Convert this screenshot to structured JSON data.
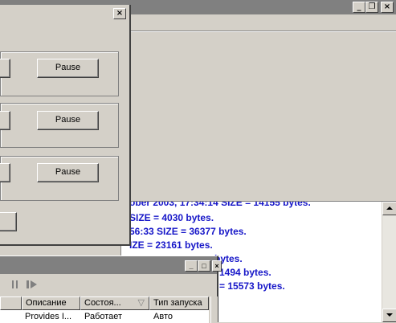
{
  "main_window": {
    "title_buttons": {
      "minimize": "_",
      "restore": "❐",
      "close": "×"
    }
  },
  "log": {
    "lines": [
      "ober 2003, 17:34:14    SIZE = 14155 bytes.",
      "SIZE = 4030 bytes.",
      "56:33    SIZE = 36377 bytes.",
      "IZE = 23161 bytes.",
      "bytes.",
      "1494 bytes.",
      "= 15573 bytes."
    ]
  },
  "dialog": {
    "close_glyph": "×",
    "pause_label": "Pause"
  },
  "services": {
    "title_buttons": {
      "minimize": "_",
      "maximize": "□",
      "close": "×"
    },
    "columns": [
      "Описание",
      "Состоя...",
      "Тип запуска"
    ],
    "sort_glyph": "▽",
    "row": [
      "Provides I...",
      "Работает",
      "Авто"
    ]
  }
}
